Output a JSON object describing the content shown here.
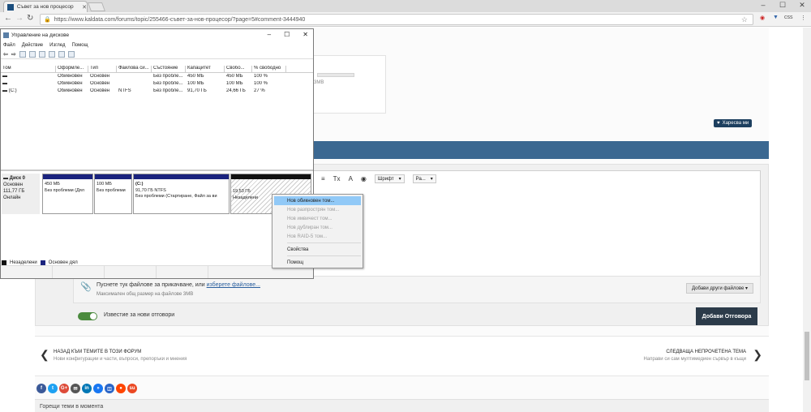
{
  "browser": {
    "tab_title": "Съвет за нов процесор",
    "url": "https://www.kaldata.com/forums/topic/255466-съвет-за-нов-процесор/?page=5#comment-3444940",
    "ext_label": "css"
  },
  "page": {
    "storage_label": "3MB",
    "like_label": "Харесва ми",
    "toolbar": {
      "font_label": "Шрифт",
      "size_label": "Ра..."
    },
    "attach_text": "Пуснете тук файлове за прикачване, или",
    "attach_link": "изберете файлове...",
    "attach_max": "Максимален общ размер на файлове 3MB",
    "more_files": "Добави други файлове ▾",
    "notify_label": "Известие за нови отговори",
    "submit_label": "Добави Отговора",
    "nav_back_title": "НАЗАД КЪМ ТЕМИТЕ В ТОЗИ ФОРУМ",
    "nav_back_sub": "Нови конфигурации и части, въпроси, препоръки и мнения",
    "nav_next_title": "СЛЕДВАЩА НЕПРОЧЕТЕНА ТЕМА",
    "nav_next_sub": "Направи си сам мултимедиен сървър в къщи",
    "hot_topics": "Горещи теми в момента",
    "social_colors": [
      "#3b5998",
      "#1da1f2",
      "#dd4b39",
      "#555555",
      "#0077b5",
      "#1877f2",
      "#2a65c7",
      "#ff4500",
      "#eb4924"
    ],
    "social_glyphs": [
      "f",
      "t",
      "G+",
      "✉",
      "in",
      "»",
      "◫",
      "●",
      "su"
    ]
  },
  "disk_mgmt": {
    "title": "Управление на дискове",
    "menu": [
      "Файл",
      "Действие",
      "Изглед",
      "Помощ"
    ],
    "columns": [
      "Том",
      "Оформле...",
      "Тип",
      "Файлова си...",
      "Състояние",
      "Капацитет",
      "Свобо...",
      "% свободно"
    ],
    "rows": [
      [
        "",
        "Обикновен",
        "Основен",
        "",
        "Без пробле...",
        "450 МБ",
        "450 МБ",
        "100 %"
      ],
      [
        "",
        "Обикновен",
        "Основен",
        "",
        "Без пробле...",
        "100 МБ",
        "100 МБ",
        "100 %"
      ],
      [
        "(C:)",
        "Обикновен",
        "Основен",
        "NTFS",
        "Без пробле...",
        "91,70 ГБ",
        "24,66 ГБ",
        "27 %"
      ]
    ],
    "disk": {
      "name": "Диск 0",
      "type": "Основен",
      "size": "111,77 ГБ",
      "status": "Онлайн"
    },
    "partitions": [
      {
        "l1": "",
        "l2": "450 МБ",
        "l3": "Без проблеми (Дял"
      },
      {
        "l1": "",
        "l2": "100 МБ",
        "l3": "Без проблеми"
      },
      {
        "l1": "(C:)",
        "l2": "91,70 ГБ NTFS",
        "l3": "Без проблеми (Стартиране, Файл за ви"
      },
      {
        "l1": "",
        "l2": "19,53 ГБ",
        "l3": "Незаделени"
      }
    ],
    "legend": [
      "Незаделени",
      "Основен дял"
    ]
  },
  "context_menu": {
    "items": [
      "Нов обикновен том...",
      "Нов разпрострян том...",
      "Нов имвичест том...",
      "Нов дублиран том...",
      "Нов RAID-5 том..."
    ],
    "properties": "Свойства",
    "help": "Помощ"
  }
}
